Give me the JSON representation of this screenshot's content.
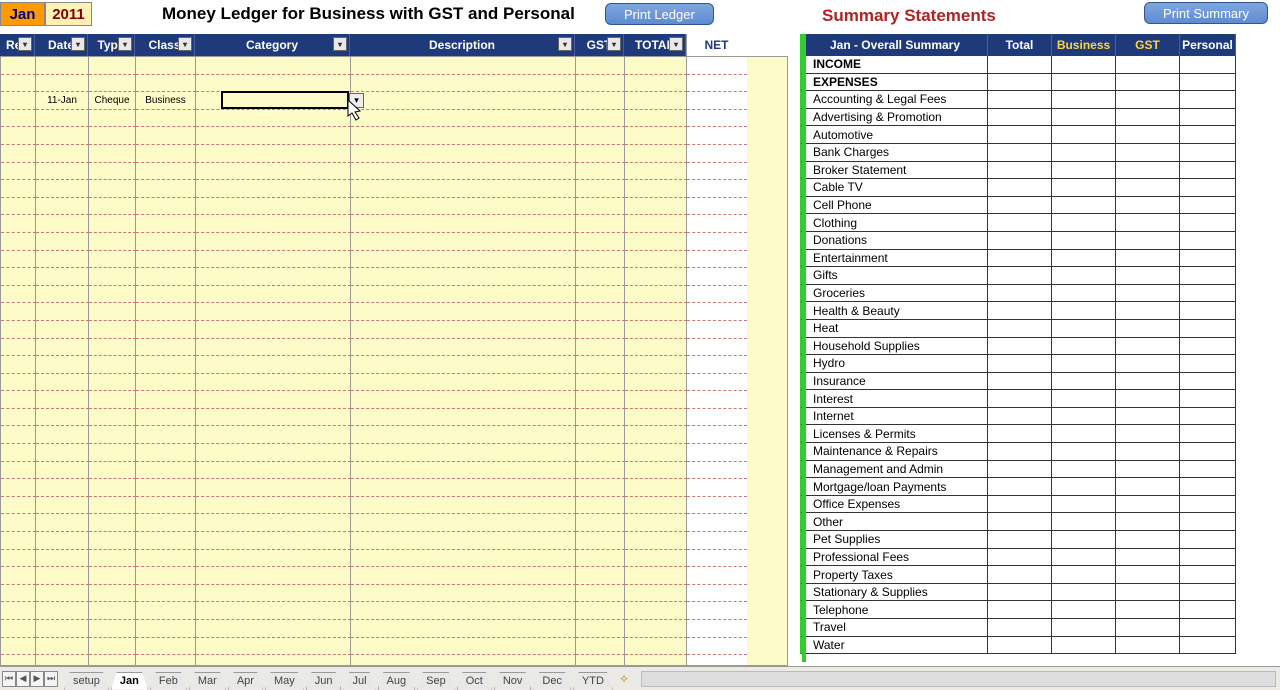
{
  "header": {
    "month": "Jan",
    "year": "2011",
    "ledger_title": "Money Ledger for Business with GST and Personal",
    "summary_title": "Summary Statements",
    "print_ledger": "Print Ledger",
    "print_summary": "Print Summary"
  },
  "columns": {
    "rec": "Rec",
    "date": "Date",
    "type": "Type",
    "class": "Class",
    "category": "Category",
    "description": "Description",
    "gst": "GST",
    "total": "TOTAL",
    "net": "NET"
  },
  "entry": {
    "date": "11-Jan",
    "type": "Cheque",
    "class": "Business"
  },
  "summary_header": {
    "title": "Jan - Overall Summary",
    "total": "Total",
    "business": "Business",
    "gst": "GST",
    "personal": "Personal"
  },
  "summary_rows": [
    {
      "label": "INCOME",
      "bold": true
    },
    {
      "label": "EXPENSES",
      "bold": true
    },
    {
      "label": "Accounting & Legal Fees"
    },
    {
      "label": "Advertising & Promotion"
    },
    {
      "label": "Automotive"
    },
    {
      "label": "Bank Charges"
    },
    {
      "label": "Broker Statement"
    },
    {
      "label": "Cable TV"
    },
    {
      "label": "Cell Phone"
    },
    {
      "label": "Clothing"
    },
    {
      "label": "Donations"
    },
    {
      "label": "Entertainment"
    },
    {
      "label": "Gifts"
    },
    {
      "label": "Groceries"
    },
    {
      "label": "Health & Beauty"
    },
    {
      "label": "Heat"
    },
    {
      "label": "Household Supplies"
    },
    {
      "label": "Hydro"
    },
    {
      "label": "Insurance"
    },
    {
      "label": "Interest"
    },
    {
      "label": "Internet"
    },
    {
      "label": "Licenses & Permits"
    },
    {
      "label": "Maintenance & Repairs"
    },
    {
      "label": "Management and Admin"
    },
    {
      "label": "Mortgage/loan Payments"
    },
    {
      "label": "Office Expenses"
    },
    {
      "label": "Other"
    },
    {
      "label": "Pet Supplies"
    },
    {
      "label": "Professional Fees"
    },
    {
      "label": "Property Taxes"
    },
    {
      "label": "Stationary & Supplies"
    },
    {
      "label": "Telephone"
    },
    {
      "label": "Travel"
    },
    {
      "label": "Water"
    }
  ],
  "tabs": [
    "setup",
    "Jan",
    "Feb",
    "Mar",
    "Apr",
    "May",
    "Jun",
    "Jul",
    "Aug",
    "Sep",
    "Oct",
    "Nov",
    "Dec",
    "YTD"
  ],
  "active_tab": "Jan"
}
